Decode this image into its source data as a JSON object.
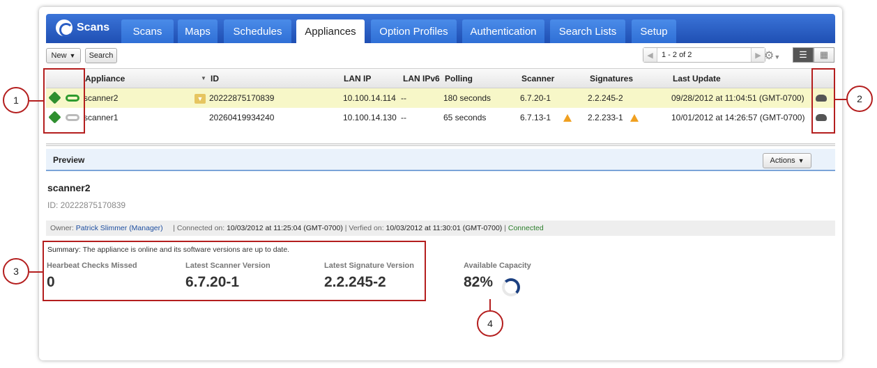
{
  "nav": {
    "logo_text": "Scans",
    "tabs": [
      "Scans",
      "Maps",
      "Schedules",
      "Appliances",
      "Option Profiles",
      "Authentication",
      "Search Lists",
      "Setup"
    ],
    "active_tab": "Appliances"
  },
  "toolbar": {
    "new_label": "New",
    "search_label": "Search",
    "pager_text": "1 - 2 of 2"
  },
  "grid": {
    "columns": [
      "Appliance",
      "ID",
      "LAN IP",
      "LAN IPv6",
      "Polling",
      "Scanner",
      "Signatures",
      "Last Update"
    ],
    "rows": [
      {
        "appliance": "scanner2",
        "id": "20222875170839",
        "lan_ip": "10.100.14.114",
        "lan_ipv6": "--",
        "polling": "180 seconds",
        "scanner": "6.7.20-1",
        "signatures": "2.2.245-2",
        "last_update": "09/28/2012 at 11:04:51 (GMT-0700)",
        "scanner_warn": false,
        "sig_warn": false
      },
      {
        "appliance": "scanner1",
        "id": "20260419934240",
        "lan_ip": "10.100.14.130",
        "lan_ipv6": "--",
        "polling": "65 seconds",
        "scanner": "6.7.13-1",
        "signatures": "2.2.233-1",
        "last_update": "10/01/2012 at 14:26:57 (GMT-0700)",
        "scanner_warn": true,
        "sig_warn": true
      }
    ]
  },
  "preview": {
    "title": "Preview",
    "actions_label": "Actions",
    "name": "scanner2",
    "id_line": "ID: 20222875170839",
    "owner_label": "Owner:",
    "owner": "Patrick Slimmer (Manager)",
    "connected_label": "| Connected on:",
    "connected_on": "10/03/2012 at 11:25:04 (GMT-0700)",
    "verified_label": "| Verfied on:",
    "verified_on": "10/03/2012 at 11:30:01 (GMT-0700)",
    "status": "Connected",
    "summary_label": "Summary:",
    "summary_text": "The appliance is online and its software versions are up to date.",
    "metrics": [
      {
        "label": "Hearbeat Checks Missed",
        "value": "0"
      },
      {
        "label": "Latest Scanner Version",
        "value": "6.7.20-1"
      },
      {
        "label": "Latest Signature Version",
        "value": "2.2.245-2"
      },
      {
        "label": "Available Capacity",
        "value": "82%"
      }
    ]
  },
  "callouts": [
    "1",
    "2",
    "3",
    "4"
  ],
  "colors": {
    "nav": "#2a5dc4",
    "callout": "#b41e1e",
    "selected_row": "#f7f7c8",
    "connected": "#2a7d2a"
  }
}
